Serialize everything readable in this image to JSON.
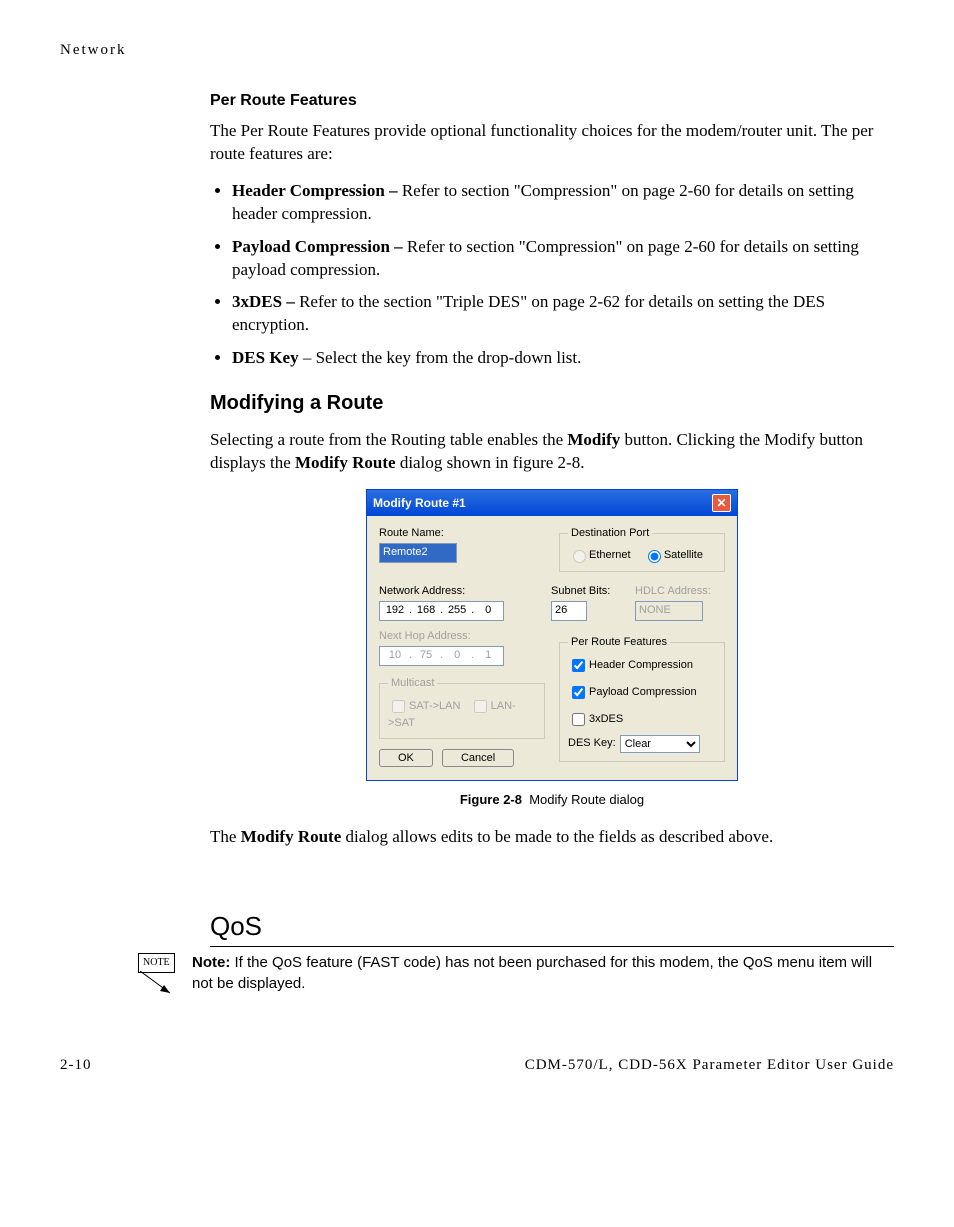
{
  "header": {
    "section": "Network"
  },
  "perRoute": {
    "title": "Per Route Features",
    "intro": "The Per Route Features provide optional functionality choices for the modem/router unit. The per route features are:",
    "bullets": [
      {
        "term": "Header Compression – ",
        "text": "Refer to section \"Compression\" on page 2-60 for details on setting header compression."
      },
      {
        "term": "Payload Compression – ",
        "text": "Refer to section \"Compression\" on page 2-60 for details on setting payload compression."
      },
      {
        "term": "3xDES – ",
        "text": "Refer to the section \"Triple DES\" on page 2-62 for details on setting the DES encryption."
      },
      {
        "term": "DES Key",
        "text": " – Select the key from the drop-down list."
      }
    ]
  },
  "modify": {
    "title": "Modifying a Route",
    "intro_pre": "Selecting a route from the Routing table enables the ",
    "intro_mod": "Modify",
    "intro_mid": " button. Clicking the Modify button displays the ",
    "intro_mr": "Modify Route",
    "intro_post": " dialog shown in figure 2-8.",
    "figLabel": "Figure 2-8",
    "figText": "Modify Route dialog",
    "outro_pre": "The ",
    "outro_mr": "Modify Route",
    "outro_post": " dialog allows edits to be made to the fields as described above."
  },
  "dialog": {
    "title": "Modify Route #1",
    "routeNameLabel": "Route Name:",
    "routeNameValue": "Remote2",
    "destPortLegend": "Destination Port",
    "destEthernet": "Ethernet",
    "destSatellite": "Satellite",
    "netAddrLabel": "Network Address:",
    "ip": {
      "a": "192",
      "b": "168",
      "c": "255",
      "d": "0"
    },
    "subnetLabel": "Subnet Bits:",
    "subnetValue": "26",
    "hdlcLabel": "HDLC Address:",
    "hdlcValue": "NONE",
    "nextHopLabel": "Next Hop Address:",
    "nextHop": {
      "a": "10",
      "b": "75",
      "c": "0",
      "d": "1"
    },
    "multicastLegend": "Multicast",
    "multicastA": "SAT->LAN",
    "multicastB": "LAN->SAT",
    "prfLegend": "Per Route Features",
    "prfHeader": "Header Compression",
    "prfPayload": "Payload Compression",
    "prf3xdes": "3xDES",
    "desKeyLabel": "DES Key:",
    "desKeyValue": "Clear",
    "ok": "OK",
    "cancel": "Cancel"
  },
  "qos": {
    "title": "QoS",
    "noteBox": "NOTE",
    "noteLabel": "Note:",
    "noteText": "If the QoS feature (FAST code) has not been purchased for this modem, the QoS menu item will not be displayed."
  },
  "footer": {
    "page": "2-10",
    "book": "CDM-570/L, CDD-56X Parameter Editor User Guide"
  }
}
